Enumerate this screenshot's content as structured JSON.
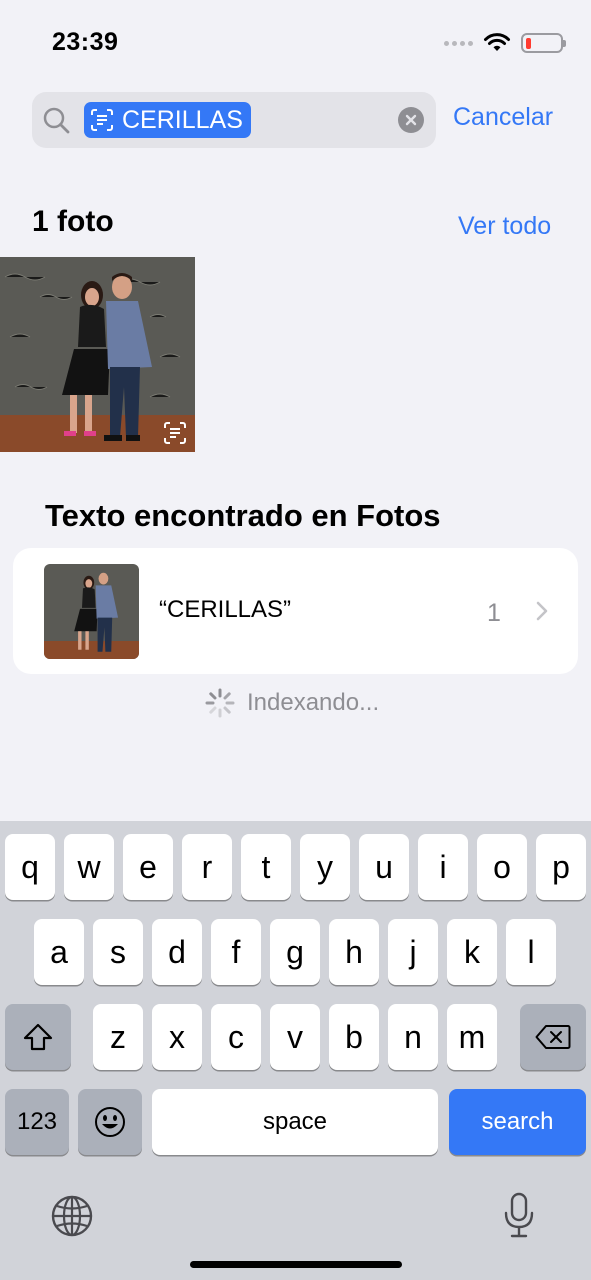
{
  "status_bar": {
    "time": "23:39"
  },
  "search": {
    "token": "CERILLAS",
    "cancel_label": "Cancelar"
  },
  "photos_section": {
    "title": "1 foto",
    "see_all": "Ver todo"
  },
  "text_found": {
    "title": "Texto encontrado en Fotos",
    "result": {
      "text": "“CERILLAS”",
      "count": "1"
    }
  },
  "indexing_label": "Indexando...",
  "keyboard": {
    "row1": [
      "q",
      "w",
      "e",
      "r",
      "t",
      "y",
      "u",
      "i",
      "o",
      "p"
    ],
    "row2": [
      "a",
      "s",
      "d",
      "f",
      "g",
      "h",
      "j",
      "k",
      "l"
    ],
    "row3": [
      "z",
      "x",
      "c",
      "v",
      "b",
      "n",
      "m"
    ],
    "numbers_label": "123",
    "space_label": "space",
    "search_label": "search"
  },
  "colors": {
    "accent": "#3478f6",
    "background": "#f2f2f7",
    "keyboard": "#d1d3d9"
  }
}
